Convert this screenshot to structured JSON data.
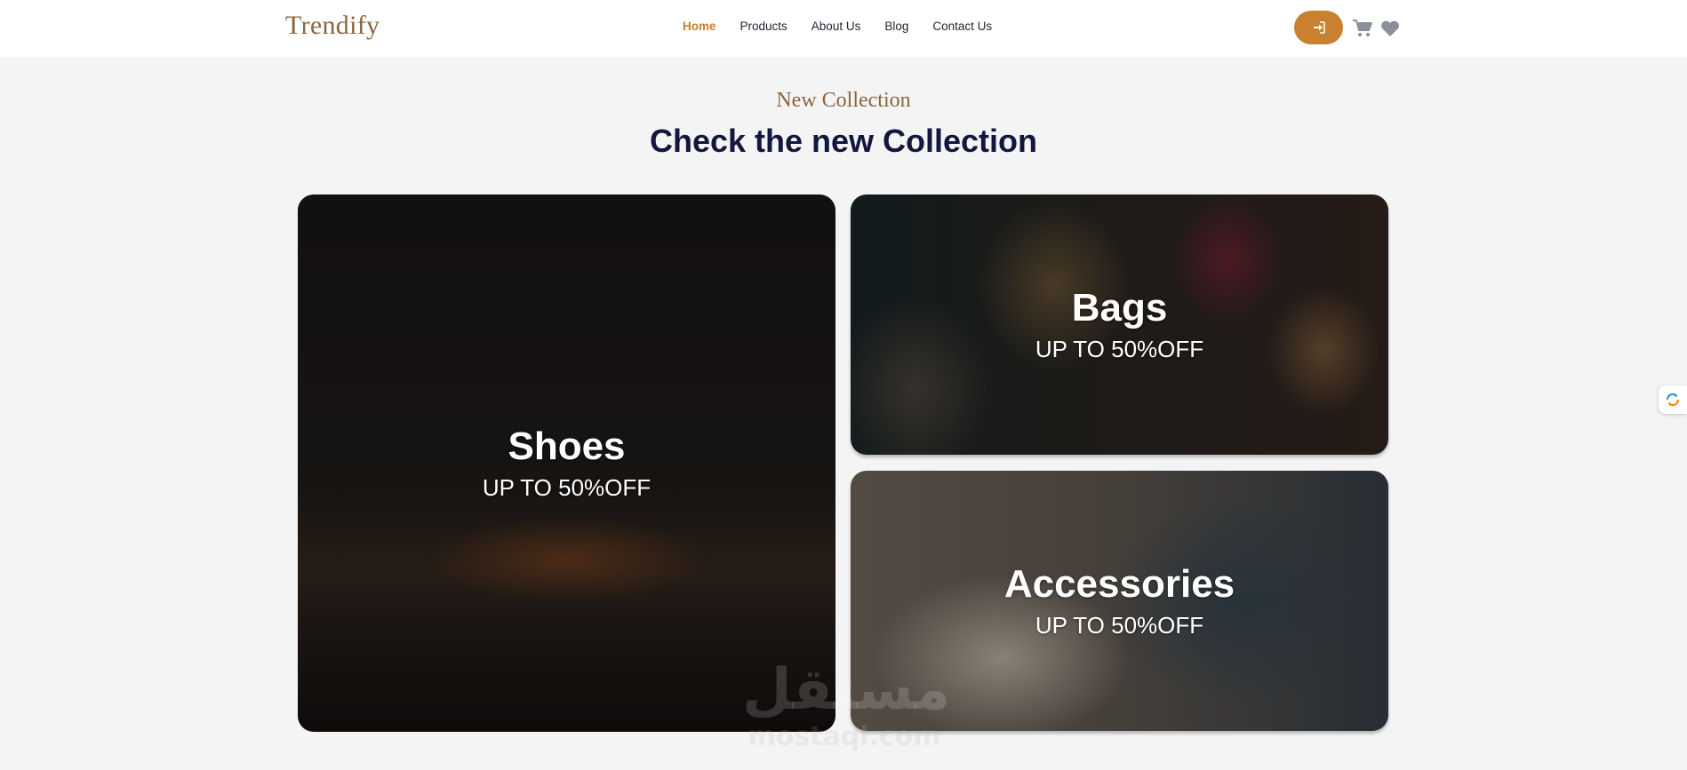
{
  "header": {
    "logo": "Trendify",
    "nav": [
      "Home",
      "Products",
      "About Us",
      "Blog",
      "Contact Us"
    ],
    "active_nav": "Home",
    "icons": [
      "login-icon",
      "cart-icon",
      "heart-icon"
    ],
    "accent_color": "#c9802f"
  },
  "section": {
    "subtitle": "New Collection",
    "title": "Check the new Collection"
  },
  "cards": [
    {
      "name": "Shoes",
      "promo": "UP TO 50%OFF"
    },
    {
      "name": "Bags",
      "promo": "UP TO 50%OFF"
    },
    {
      "name": "Accessories",
      "promo": "UP TO 50%OFF"
    }
  ],
  "watermark": {
    "arabic": "مستقل",
    "latin": "mostaql.com"
  }
}
